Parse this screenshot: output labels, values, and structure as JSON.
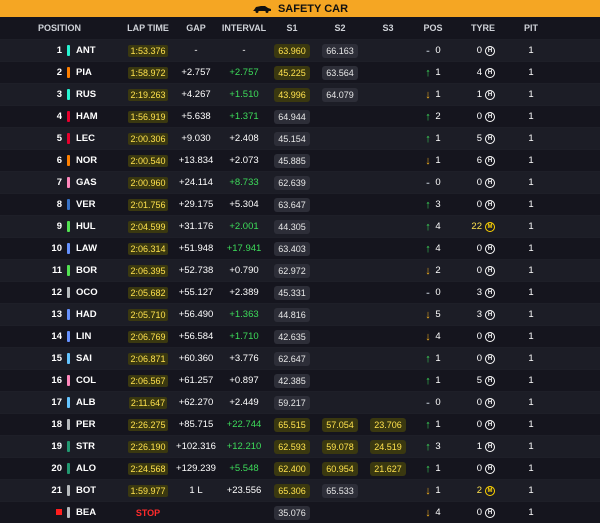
{
  "banner": {
    "label": "SAFETY CAR"
  },
  "headers": {
    "position": "POSITION",
    "lap_time": "LAP TIME",
    "gap": "GAP",
    "interval": "INTERVAL",
    "s1": "S1",
    "s2": "S2",
    "s3": "S3",
    "pos": "POS",
    "tyre": "TYRE",
    "pit": "PIT"
  },
  "colors": {
    "banner": "#f5a623",
    "lap_highlight": "#ffe24d",
    "gain": "#3ddc5a",
    "loss": "#f5b11c",
    "stop": "#ff2b2b"
  },
  "rows": [
    {
      "pos": "1",
      "code": "ANT",
      "team": "#27f4d2",
      "lap": "1:53.376",
      "gap": "-",
      "int": "-",
      "int_green": false,
      "s1": "63.960",
      "s1c": "y",
      "s2": "66.163",
      "s2c": "",
      "s3": "",
      "s3c": "",
      "dir": "flat",
      "arrow": "-",
      "ch": "0",
      "tyre_age": "0",
      "tyre": "H",
      "pit": "1"
    },
    {
      "pos": "2",
      "code": "PIA",
      "team": "#ff8000",
      "lap": "1:58.972",
      "gap": "+2.757",
      "int": "+2.757",
      "int_green": true,
      "s1": "45.225",
      "s1c": "y",
      "s2": "63.564",
      "s2c": "",
      "s3": "",
      "s3c": "",
      "dir": "up",
      "arrow": "↑",
      "ch": "1",
      "tyre_age": "4",
      "tyre": "H",
      "pit": "1"
    },
    {
      "pos": "3",
      "code": "RUS",
      "team": "#27f4d2",
      "lap": "2:19.263",
      "gap": "+4.267",
      "int": "+1.510",
      "int_green": true,
      "s1": "43.996",
      "s1c": "y",
      "s2": "64.079",
      "s2c": "",
      "s3": "",
      "s3c": "",
      "dir": "down",
      "arrow": "↓",
      "ch": "1",
      "tyre_age": "1",
      "tyre": "H",
      "pit": "1"
    },
    {
      "pos": "4",
      "code": "HAM",
      "team": "#e8002d",
      "lap": "1:56.919",
      "gap": "+5.638",
      "int": "+1.371",
      "int_green": true,
      "s1": "64.944",
      "s1c": "",
      "s2": "",
      "s2c": "",
      "s3": "",
      "s3c": "",
      "dir": "up",
      "arrow": "↑",
      "ch": "2",
      "tyre_age": "0",
      "tyre": "H",
      "pit": "1"
    },
    {
      "pos": "5",
      "code": "LEC",
      "team": "#e8002d",
      "lap": "2:00.306",
      "gap": "+9.030",
      "int": "+2.408",
      "int_green": false,
      "s1": "45.154",
      "s1c": "",
      "s2": "",
      "s2c": "",
      "s3": "",
      "s3c": "",
      "dir": "up",
      "arrow": "↑",
      "ch": "1",
      "tyre_age": "5",
      "tyre": "H",
      "pit": "1"
    },
    {
      "pos": "6",
      "code": "NOR",
      "team": "#ff8000",
      "lap": "2:00.540",
      "gap": "+13.834",
      "int": "+2.073",
      "int_green": false,
      "s1": "45.885",
      "s1c": "",
      "s2": "",
      "s2c": "",
      "s3": "",
      "s3c": "",
      "dir": "down",
      "arrow": "↓",
      "ch": "1",
      "tyre_age": "6",
      "tyre": "H",
      "pit": "1"
    },
    {
      "pos": "7",
      "code": "GAS",
      "team": "#ff87bc",
      "lap": "2:00.960",
      "gap": "+24.114",
      "int": "+8.733",
      "int_green": true,
      "s1": "62.639",
      "s1c": "",
      "s2": "",
      "s2c": "",
      "s3": "",
      "s3c": "",
      "dir": "flat",
      "arrow": "-",
      "ch": "0",
      "tyre_age": "0",
      "tyre": "H",
      "pit": "1"
    },
    {
      "pos": "8",
      "code": "VER",
      "team": "#3671c6",
      "lap": "2:01.756",
      "gap": "+29.175",
      "int": "+5.304",
      "int_green": false,
      "s1": "63.647",
      "s1c": "",
      "s2": "",
      "s2c": "",
      "s3": "",
      "s3c": "",
      "dir": "up",
      "arrow": "↑",
      "ch": "3",
      "tyre_age": "0",
      "tyre": "H",
      "pit": "1"
    },
    {
      "pos": "9",
      "code": "HUL",
      "team": "#52e252",
      "lap": "2:04.599",
      "gap": "+31.176",
      "int": "+2.001",
      "int_green": true,
      "s1": "44.305",
      "s1c": "",
      "s2": "",
      "s2c": "",
      "s3": "",
      "s3c": "",
      "dir": "up",
      "arrow": "↑",
      "ch": "4",
      "tyre_age": "22",
      "tyre": "M",
      "pit": "1"
    },
    {
      "pos": "10",
      "code": "LAW",
      "team": "#6692ff",
      "lap": "2:06.314",
      "gap": "+51.948",
      "int": "+17.941",
      "int_green": true,
      "s1": "63.403",
      "s1c": "",
      "s2": "",
      "s2c": "",
      "s3": "",
      "s3c": "",
      "dir": "up",
      "arrow": "↑",
      "ch": "4",
      "tyre_age": "0",
      "tyre": "H",
      "pit": "1"
    },
    {
      "pos": "11",
      "code": "BOR",
      "team": "#52e252",
      "lap": "2:06.395",
      "gap": "+52.738",
      "int": "+0.790",
      "int_green": false,
      "s1": "62.972",
      "s1c": "",
      "s2": "",
      "s2c": "",
      "s3": "",
      "s3c": "",
      "dir": "down",
      "arrow": "↓",
      "ch": "2",
      "tyre_age": "0",
      "tyre": "H",
      "pit": "1"
    },
    {
      "pos": "12",
      "code": "OCO",
      "team": "#b6babd",
      "lap": "2:05.682",
      "gap": "+55.127",
      "int": "+2.389",
      "int_green": false,
      "s1": "45.331",
      "s1c": "",
      "s2": "",
      "s2c": "",
      "s3": "",
      "s3c": "",
      "dir": "flat",
      "arrow": "-",
      "ch": "0",
      "tyre_age": "3",
      "tyre": "H",
      "pit": "1"
    },
    {
      "pos": "13",
      "code": "HAD",
      "team": "#6692ff",
      "lap": "2:05.710",
      "gap": "+56.490",
      "int": "+1.363",
      "int_green": true,
      "s1": "44.816",
      "s1c": "",
      "s2": "",
      "s2c": "",
      "s3": "",
      "s3c": "",
      "dir": "down",
      "arrow": "↓",
      "ch": "5",
      "tyre_age": "3",
      "tyre": "H",
      "pit": "1"
    },
    {
      "pos": "14",
      "code": "LIN",
      "team": "#6692ff",
      "lap": "2:06.769",
      "gap": "+56.584",
      "int": "+1.710",
      "int_green": true,
      "s1": "42.635",
      "s1c": "",
      "s2": "",
      "s2c": "",
      "s3": "",
      "s3c": "",
      "dir": "down",
      "arrow": "↓",
      "ch": "4",
      "tyre_age": "0",
      "tyre": "H",
      "pit": "1"
    },
    {
      "pos": "15",
      "code": "SAI",
      "team": "#64c4ff",
      "lap": "2:06.871",
      "gap": "+60.360",
      "int": "+3.776",
      "int_green": false,
      "s1": "62.647",
      "s1c": "",
      "s2": "",
      "s2c": "",
      "s3": "",
      "s3c": "",
      "dir": "up",
      "arrow": "↑",
      "ch": "1",
      "tyre_age": "0",
      "tyre": "H",
      "pit": "1"
    },
    {
      "pos": "16",
      "code": "COL",
      "team": "#ff87bc",
      "lap": "2:06.567",
      "gap": "+61.257",
      "int": "+0.897",
      "int_green": false,
      "s1": "42.385",
      "s1c": "",
      "s2": "",
      "s2c": "",
      "s3": "",
      "s3c": "",
      "dir": "up",
      "arrow": "↑",
      "ch": "1",
      "tyre_age": "5",
      "tyre": "H",
      "pit": "1"
    },
    {
      "pos": "17",
      "code": "ALB",
      "team": "#64c4ff",
      "lap": "2:11.647",
      "gap": "+62.270",
      "int": "+2.449",
      "int_green": false,
      "s1": "59.217",
      "s1c": "",
      "s2": "",
      "s2c": "",
      "s3": "",
      "s3c": "",
      "dir": "flat",
      "arrow": "-",
      "ch": "0",
      "tyre_age": "0",
      "tyre": "H",
      "pit": "1"
    },
    {
      "pos": "18",
      "code": "PER",
      "team": "#b6babd",
      "lap": "2:26.275",
      "gap": "+85.715",
      "int": "+22.744",
      "int_green": true,
      "s1": "65.515",
      "s1c": "y",
      "s2": "57.054",
      "s2c": "y",
      "s3": "23.706",
      "s3c": "y",
      "dir": "up",
      "arrow": "↑",
      "ch": "1",
      "tyre_age": "0",
      "tyre": "H",
      "pit": "1"
    },
    {
      "pos": "19",
      "code": "STR",
      "team": "#229971",
      "lap": "2:26.190",
      "gap": "+102.316",
      "int": "+12.210",
      "int_green": true,
      "s1": "62.593",
      "s1c": "y",
      "s2": "59.078",
      "s2c": "y",
      "s3": "24.519",
      "s3c": "y",
      "dir": "up",
      "arrow": "↑",
      "ch": "3",
      "tyre_age": "1",
      "tyre": "H",
      "pit": "1"
    },
    {
      "pos": "20",
      "code": "ALO",
      "team": "#229971",
      "lap": "2:24.568",
      "gap": "+129.239",
      "int": "+5.548",
      "int_green": true,
      "s1": "62.400",
      "s1c": "y",
      "s2": "60.954",
      "s2c": "y",
      "s3": "21.627",
      "s3c": "y",
      "dir": "up",
      "arrow": "↑",
      "ch": "1",
      "tyre_age": "0",
      "tyre": "H",
      "pit": "1"
    },
    {
      "pos": "21",
      "code": "BOT",
      "team": "#b6babd",
      "lap": "1:59.977",
      "gap": "1 L",
      "int": "+23.556",
      "int_green": false,
      "s1": "65.306",
      "s1c": "y",
      "s2": "65.533",
      "s2c": "",
      "s3": "",
      "s3c": "",
      "dir": "down",
      "arrow": "↓",
      "ch": "1",
      "tyre_age": "2",
      "tyre": "M",
      "pit": "1"
    },
    {
      "pos": "",
      "code": "BEA",
      "team": "#b6babd",
      "lap": "STOP",
      "gap": "",
      "int": "",
      "int_green": false,
      "s1": "35.076",
      "s1c": "",
      "s2": "",
      "s2c": "",
      "s3": "",
      "s3c": "",
      "dir": "down",
      "arrow": "↓",
      "ch": "4",
      "tyre_age": "0",
      "tyre": "H",
      "pit": "1",
      "flag": true
    }
  ]
}
